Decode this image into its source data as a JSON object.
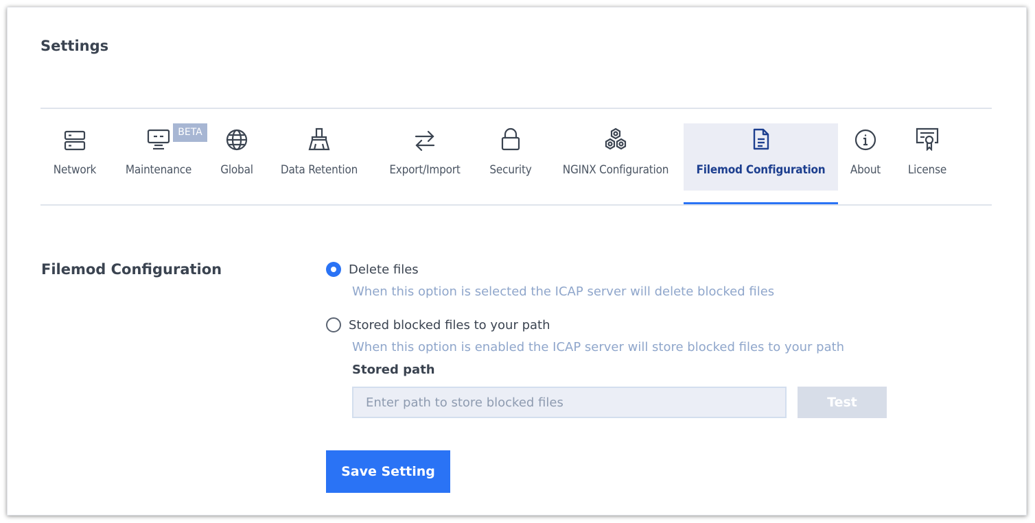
{
  "page": {
    "title": "Settings"
  },
  "tabs": [
    {
      "key": "network",
      "label": "Network",
      "icon": "server-icon"
    },
    {
      "key": "maintenance",
      "label": "Maintenance",
      "icon": "monitor-icon",
      "badge": "BETA"
    },
    {
      "key": "global",
      "label": "Global",
      "icon": "globe-icon"
    },
    {
      "key": "data-retention",
      "label": "Data Retention",
      "icon": "broom-icon"
    },
    {
      "key": "export-import",
      "label": "Export/Import",
      "icon": "swap-arrows-icon"
    },
    {
      "key": "security",
      "label": "Security",
      "icon": "lock-icon"
    },
    {
      "key": "nginx",
      "label": "NGINX Configuration",
      "icon": "hexagons-icon"
    },
    {
      "key": "filemod",
      "label": "Filemod Configuration",
      "icon": "document-icon",
      "active": true
    },
    {
      "key": "about",
      "label": "About",
      "icon": "info-icon"
    },
    {
      "key": "license",
      "label": "License",
      "icon": "certificate-icon"
    }
  ],
  "filemod": {
    "section_label": "Filemod Configuration",
    "options": [
      {
        "label": "Delete files",
        "hint": "When this option is selected the ICAP server will delete blocked files",
        "selected": true
      },
      {
        "label": "Stored blocked files to your path",
        "hint": "When this option is enabled the ICAP server will store blocked files to your path",
        "selected": false
      }
    ],
    "path_label": "Stored path",
    "path_value": "",
    "path_placeholder": "Enter path to store blocked files",
    "test_label": "Test",
    "save_label": "Save Setting"
  },
  "colors": {
    "accent": "#2a73f5",
    "active_tab_bg": "#ebedf5",
    "active_tab_text": "#1d3f8f",
    "hint_text": "#8fa6cb",
    "badge_bg": "#a7b6d3"
  }
}
